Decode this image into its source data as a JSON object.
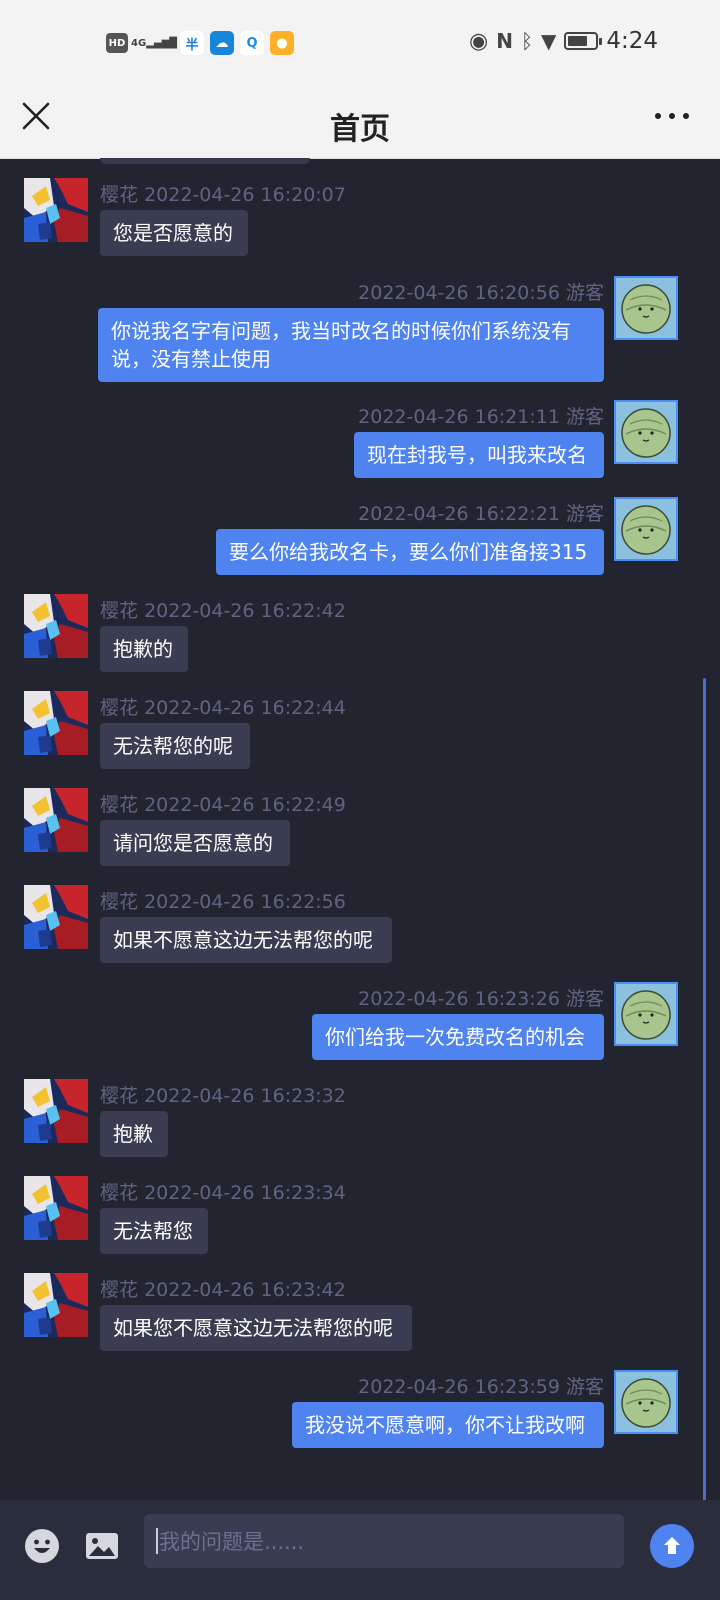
{
  "status_bar": {
    "hd": "HD",
    "network": "4G",
    "app_a_glyph": "半",
    "time": "4:24",
    "battery_level": 0.7
  },
  "header": {
    "title": "首页"
  },
  "chat": {
    "agent_name": "樱花",
    "user_name": "游客",
    "messages": [
      {
        "role": "agent",
        "time": "2022-04-26 16:20:07",
        "text": "您是否愿意的"
      },
      {
        "role": "user",
        "time": "2022-04-26 16:20:56",
        "text": "你说我名字有问题，我当时改名的时候你们系统没有说，没有禁止使用"
      },
      {
        "role": "user",
        "time": "2022-04-26 16:21:11",
        "text": "现在封我号，叫我来改名"
      },
      {
        "role": "user",
        "time": "2022-04-26 16:22:21",
        "text": "要么你给我改名卡，要么你们准备接315"
      },
      {
        "role": "agent",
        "time": "2022-04-26 16:22:42",
        "text": "抱歉的"
      },
      {
        "role": "agent",
        "time": "2022-04-26 16:22:44",
        "text": "无法帮您的呢"
      },
      {
        "role": "agent",
        "time": "2022-04-26 16:22:49",
        "text": "请问您是否愿意的"
      },
      {
        "role": "agent",
        "time": "2022-04-26 16:22:56",
        "text": "如果不愿意这边无法帮您的呢"
      },
      {
        "role": "user",
        "time": "2022-04-26 16:23:26",
        "text": "你们给我一次免费改名的机会"
      },
      {
        "role": "agent",
        "time": "2022-04-26 16:23:32",
        "text": "抱歉"
      },
      {
        "role": "agent",
        "time": "2022-04-26 16:23:34",
        "text": "无法帮您"
      },
      {
        "role": "agent",
        "time": "2022-04-26 16:23:42",
        "text": "如果您不愿意这边无法帮您的呢"
      },
      {
        "role": "user",
        "time": "2022-04-26 16:23:59",
        "text": "我没说不愿意啊，你不让我改啊"
      }
    ]
  },
  "input": {
    "placeholder": "我的问题是......"
  },
  "colors": {
    "background": "#22242f",
    "agent_bubble": "#3a3d52",
    "user_bubble": "#4f83f0",
    "meta_text": "#5f6483"
  }
}
